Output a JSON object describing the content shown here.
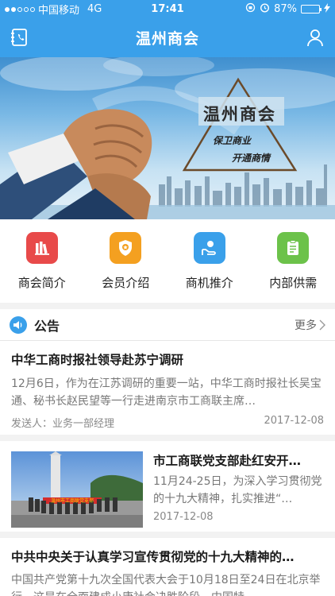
{
  "status_bar": {
    "carrier": "中国移动",
    "network": "4G",
    "time": "17:41",
    "battery_percent": "87%",
    "battery_level": 0.87
  },
  "nav": {
    "title": "温州商会",
    "left_icon": "contacts-book-icon",
    "right_icon": "user-icon"
  },
  "banner": {
    "title": "温州商会",
    "slogan_line1": "保卫商业",
    "slogan_line2": "开通商情"
  },
  "menu": [
    {
      "label": "商会简介",
      "icon": "books-icon",
      "color": "#e84a4a"
    },
    {
      "label": "会员介绍",
      "icon": "badge-icon",
      "color": "#f4a020"
    },
    {
      "label": "商机推介",
      "icon": "hand-coin-icon",
      "color": "#3aa0ea"
    },
    {
      "label": "内部供需",
      "icon": "clipboard-icon",
      "color": "#6cc24a"
    }
  ],
  "notice": {
    "title": "公告",
    "more": "更多"
  },
  "news": {
    "item1": {
      "title": "中华工商时报社领导赴苏宁调研",
      "summary": "12月6日，作为在江苏调研的重要一站，中华工商时报社长吴宝通、秘书长赵民望等一行走进南京市工商联主席…",
      "sender": "发送人：业务一部经理",
      "date": "2017-12-08"
    },
    "item2": {
      "title": "市工商联党支部赴红安开…",
      "summary": "11月24-25日，为深入学习贯彻党的十九大精神，扎实推进“…",
      "date": "2017-12-08",
      "banner_text": "温州市工商联党支部"
    },
    "item3": {
      "title": "中共中央关于认真学习宣传贯彻党的十九大精神的…",
      "summary": "中国共产党第十九次全国代表大会于10月18日至24日在北京举行。这是在全面建成小康社会决胜阶段、中国特…"
    }
  }
}
